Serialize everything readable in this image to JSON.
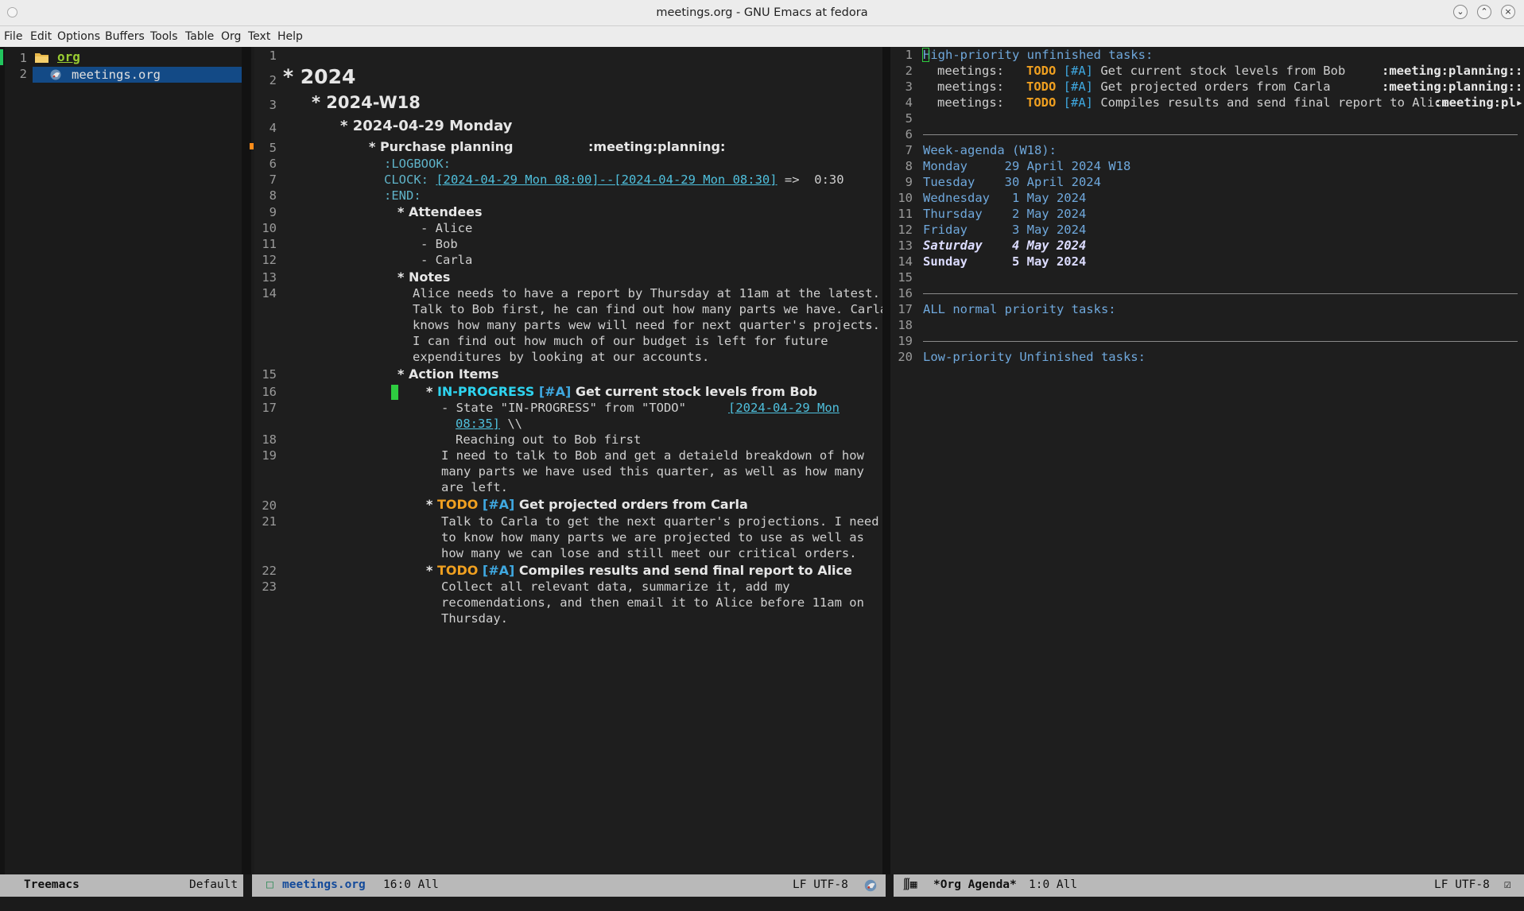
{
  "window": {
    "title": "meetings.org - GNU Emacs at fedora"
  },
  "menu": [
    "File",
    "Edit",
    "Options",
    "Buffers",
    "Tools",
    "Table",
    "Org",
    "Text",
    "Help"
  ],
  "treemacs": {
    "lines": [
      "1",
      "2"
    ],
    "folder": "org",
    "file": "meetings.org"
  },
  "editor": {
    "line_numbers": [
      "1",
      "2",
      "3",
      "4",
      "5",
      "6",
      "7",
      "8",
      "9",
      "10",
      "11",
      "12",
      "13",
      "14",
      "15",
      "16",
      "17",
      "18",
      "19",
      "20",
      "21",
      "22",
      "23"
    ],
    "h_2024": "2024",
    "h_week": "2024-W18",
    "h_day": "2024-04-29 Monday",
    "h_purchase": "Purchase planning",
    "tags": ":meeting:planning:",
    "logbook": ":LOGBOOK:",
    "clock_label": "CLOCK: ",
    "clock_link": "[2024-04-29 Mon 08:00]--[2024-04-29 Mon 08:30]",
    "clock_result": " =>  0:30",
    "end": ":END:",
    "h_attendees": "Attendees",
    "attendees": [
      "- Alice",
      "- Bob",
      "- Carla"
    ],
    "h_notes": "Notes",
    "notes": [
      "Alice needs to have a report by Thursday at 11am at the latest.",
      "Talk to Bob first, he can find out how many parts we have. Carla",
      "knows how many parts wew will need for next quarter's projects.",
      "I can find out how much of our budget is left for future",
      "expenditures by looking at our accounts."
    ],
    "h_action": "Action Items",
    "task1_state": "IN-PROGRESS",
    "prio": "[#A]",
    "task1_title": "Get current stock levels from Bob",
    "task1_log_a": "- State \"IN-PROGRESS\" from \"TODO\"",
    "task1_log_link1": "[2024-04-29 Mon",
    "task1_log_link2": "08:35]",
    "task1_log_b": " \\\\",
    "task1_log_c": "Reaching out to Bob first",
    "task1_body": [
      "I need to talk to Bob and get a detaield breakdown of how",
      "many parts we have used this quarter, as well as how many",
      "are left."
    ],
    "todo": "TODO",
    "task2_title": "Get projected orders from Carla",
    "task2_body": [
      "Talk to Carla to get the next quarter's projections. I need",
      "to know how many parts we are projected to use as well as",
      "how many we can lose and still meet our critical orders."
    ],
    "task3_title": "Compiles results and send final report to Alice",
    "task3_body": [
      "Collect all relevant data, summarize it, add my",
      "recomendations, and then email it to Alice before 11am on",
      "Thursday."
    ]
  },
  "agenda": {
    "line_numbers": [
      "1",
      "2",
      "3",
      "4",
      "5",
      "6",
      "7",
      "8",
      "9",
      "10",
      "11",
      "12",
      "13",
      "14",
      "15",
      "16",
      "17",
      "18",
      "19",
      "20"
    ],
    "high_heading": "High-priority unfinished tasks:",
    "items": [
      {
        "cat": "meetings:",
        "state": "TODO",
        "prio": "[#A]",
        "title": "Get current stock levels from Bob      ",
        "tags": ":meeting:planning::"
      },
      {
        "cat": "meetings:",
        "state": "TODO",
        "prio": "[#A]",
        "title": "Get projected orders from Carla        ",
        "tags": ":meeting:planning::"
      },
      {
        "cat": "meetings:",
        "state": "TODO",
        "prio": "[#A]",
        "title": "Compiles results and send final report to Alice",
        "tags": ":meeting:pl▸"
      }
    ],
    "week_heading": "Week-agenda (W18):",
    "days": [
      "Monday     29 April 2024 W18",
      "Tuesday    30 April 2024",
      "Wednesday   1 May 2024",
      "Thursday    2 May 2024",
      "Friday      3 May 2024",
      "Saturday    4 May 2024",
      "Sunday      5 May 2024"
    ],
    "normal_heading": "ALL normal priority tasks:",
    "low_heading": "Low-priority Unfinished tasks:"
  },
  "modeline": {
    "treemacs_name": "Treemacs",
    "treemacs_ws": "Default",
    "mid_file": "meetings.org",
    "mid_pos": "16:0 All",
    "mid_enc": "LF UTF-8",
    "right_buf": "*Org Agenda*",
    "right_pos": "1:0 All",
    "right_enc": "LF UTF-8"
  }
}
